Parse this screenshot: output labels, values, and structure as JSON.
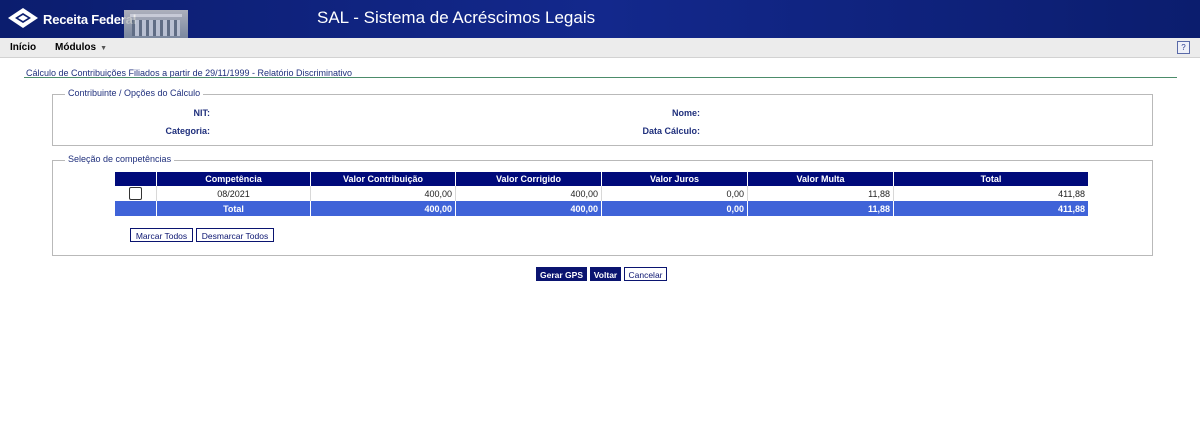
{
  "header": {
    "logo_text": "Receita Federal",
    "app_title": "SAL - Sistema de Acréscimos Legais",
    "colors": {
      "banner": "#13288c",
      "accent": "#000a7a",
      "total_row": "#3f63d8"
    }
  },
  "menu": {
    "items": [
      {
        "label": "Início"
      },
      {
        "label": "Módulos"
      }
    ],
    "help_label": "?"
  },
  "page": {
    "title": "Cálculo de Contribuições Filiados a partir de 29/11/1999 - Relatório Discriminativo"
  },
  "contribuinte": {
    "legend": "Contribuinte / Opções do Cálculo",
    "nit_label": "NIT:",
    "nit_value": "",
    "nome_label": "Nome:",
    "nome_value": "",
    "categoria_label": "Categoria:",
    "categoria_value": "",
    "data_calculo_label": "Data Cálculo:",
    "data_calculo_value": ""
  },
  "competencias": {
    "legend": "Seleção de competências",
    "columns": [
      "Competência",
      "Valor Contribuição",
      "Valor Corrigido",
      "Valor Juros",
      "Valor Multa",
      "Total"
    ],
    "rows": [
      {
        "checked": false,
        "competencia": "08/2021",
        "valor_contribuicao": "400,00",
        "valor_corrigido": "400,00",
        "valor_juros": "0,00",
        "valor_multa": "11,88",
        "total": "411,88"
      }
    ],
    "totals": {
      "label": "Total",
      "valor_contribuicao": "400,00",
      "valor_corrigido": "400,00",
      "valor_juros": "0,00",
      "valor_multa": "11,88",
      "total": "411,88"
    },
    "marcar_todos": "Marcar Todos",
    "desmarcar_todos": "Desmarcar Todos"
  },
  "actions": {
    "gerar_gps": "Gerar GPS",
    "voltar": "Voltar",
    "cancelar": "Cancelar"
  }
}
